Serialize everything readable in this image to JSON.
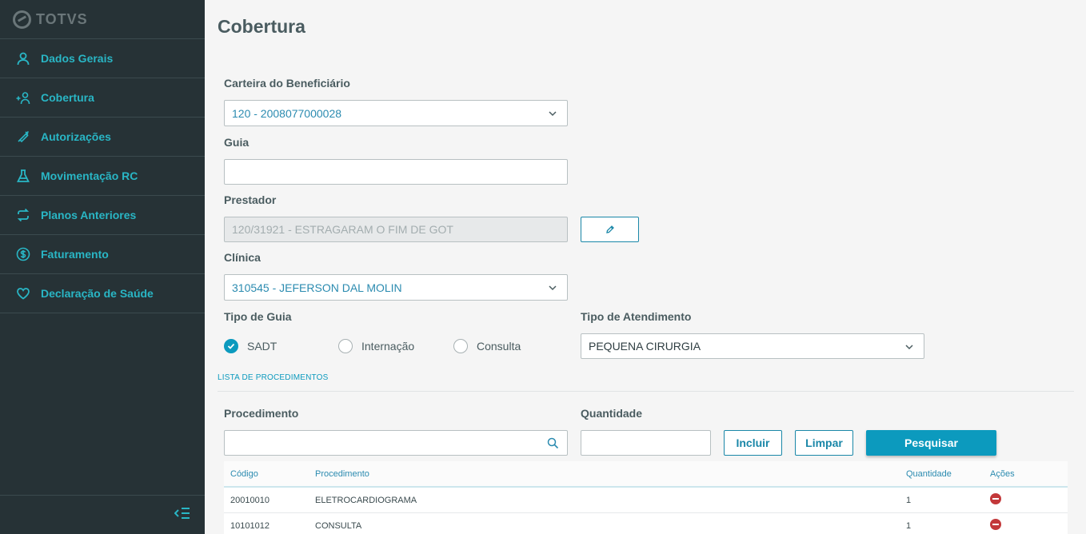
{
  "brand": {
    "logo_text": "TOTVS"
  },
  "sidebar": {
    "items": [
      {
        "label": "Dados Gerais",
        "icon": "user-icon"
      },
      {
        "label": "Cobertura",
        "icon": "add-user-icon"
      },
      {
        "label": "Autorizações",
        "icon": "syringe-icon"
      },
      {
        "label": "Movimentação RC",
        "icon": "flask-icon"
      },
      {
        "label": "Planos Anteriores",
        "icon": "refresh-icon"
      },
      {
        "label": "Faturamento",
        "icon": "dollar-icon"
      },
      {
        "label": "Declaração de Saúde",
        "icon": "heart-icon"
      }
    ],
    "toggle_icon": "collapse-menu-icon"
  },
  "page": {
    "title": "Cobertura"
  },
  "form": {
    "carteira": {
      "label": "Carteira do Beneficiário",
      "value": "120 - 2008077000028"
    },
    "guia": {
      "label": "Guia",
      "value": ""
    },
    "prestador": {
      "label": "Prestador",
      "value": "120/31921 - ESTRAGARAM O FIM DE GOT"
    },
    "clinica": {
      "label": "Clínica",
      "value": "310545 - JEFERSON DAL MOLIN"
    },
    "tipo_guia": {
      "label": "Tipo de Guia",
      "options": [
        "SADT",
        "Internação",
        "Consulta"
      ],
      "selected": "SADT"
    },
    "tipo_atendimento": {
      "label": "Tipo de Atendimento",
      "value": "PEQUENA CIRURGIA"
    }
  },
  "procedures": {
    "section_title": "LISTA DE PROCEDIMENTOS",
    "procedimento_label": "Procedimento",
    "procedimento_value": "",
    "quantidade_label": "Quantidade",
    "quantidade_value": "",
    "buttons": {
      "incluir": "Incluir",
      "limpar": "Limpar",
      "pesquisar": "Pesquisar"
    },
    "table": {
      "columns": [
        "Código",
        "Procedimento",
        "Quantidade",
        "Ações"
      ],
      "rows": [
        {
          "codigo": "20010010",
          "procedimento": "ELETROCARDIOGRAMA",
          "quantidade": "1"
        },
        {
          "codigo": "10101012",
          "procedimento": "CONSULTA",
          "quantidade": "1"
        }
      ]
    }
  },
  "colors": {
    "sidebar_bg": "#263236",
    "accent": "#29b6c5",
    "primary": "#0c9abe",
    "danger": "#c3383a"
  }
}
